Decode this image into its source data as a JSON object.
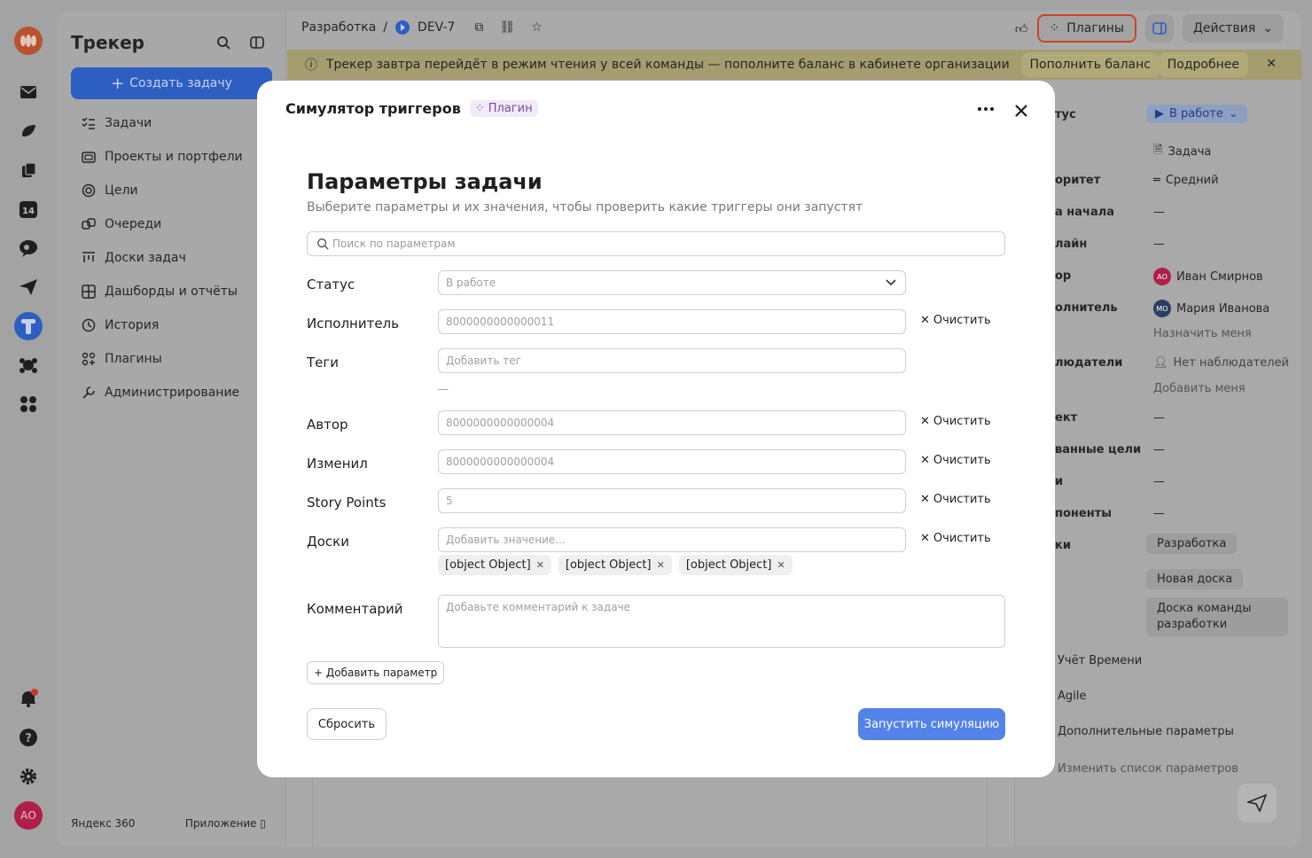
{
  "rail": {
    "avatar_initials": "АО"
  },
  "sidebar": {
    "logo": "Трекер",
    "create_label": "Создать задачу",
    "items": [
      {
        "label": "Задачи"
      },
      {
        "label": "Проекты и портфели"
      },
      {
        "label": "Цели"
      },
      {
        "label": "Очереди"
      },
      {
        "label": "Доски задач"
      },
      {
        "label": "Дашборды и отчёты"
      },
      {
        "label": "История"
      },
      {
        "label": "Плагины"
      },
      {
        "label": "Администрирование"
      }
    ],
    "footer_brand": "Яндекс 360",
    "footer_app": "Приложение"
  },
  "topbar": {
    "crumb_project": "Разработка",
    "crumb_sep": "/",
    "crumb_issue": "DEV-7",
    "plugins_label": "Плагины",
    "actions_label": "Действия"
  },
  "banner": {
    "text": "Трекер завтра перейдёт в режим чтения у всей команды — пополните баланс в кабинете организации",
    "topup_label": "Пополнить баланс",
    "more_label": "Подробнее"
  },
  "right_panel": {
    "status_label": "тус",
    "status_value": "В работе",
    "type_value": "Задача",
    "priority_label": "оритет",
    "priority_value": "Средний",
    "start_label": "а начала",
    "start_value": "—",
    "deadline_label": "лайн",
    "deadline_value": "—",
    "author_label": "ор",
    "author_value": "Иван Смирнов",
    "author_initials": "АО",
    "assignee_label": "олнитель",
    "assignee_value": "Мария Иванова",
    "assignee_initials": "МО",
    "assign_me": "Назначить меня",
    "watchers_label": "людатели",
    "watchers_value": "Нет наблюдателей",
    "add_me": "Добавить меня",
    "project_label": "ект",
    "project_value": "—",
    "goals_label": "ванные цели",
    "goals_value": "—",
    "tags_label": "и",
    "tags_value": "—",
    "components_label": "поненты",
    "components_value": "—",
    "boards_label": "ки",
    "boards": [
      "Разработка",
      "Новая доска",
      "Доска команды разработки"
    ],
    "section_time": "Учёт Времени",
    "section_agile": "Agile",
    "section_extra": "Дополнительные параметры",
    "change_params": "Изменить список параметров"
  },
  "modal": {
    "title": "Симулятор триггеров",
    "badge": "Плагин",
    "heading": "Параметры задачи",
    "subtitle": "Выберите параметры и их значения, чтобы проверить какие триггеры они запустят",
    "search_placeholder": "Поиск по параметрам",
    "clear_label": "Очистить",
    "fields": {
      "status": {
        "label": "Статус",
        "value": "В работе"
      },
      "assignee": {
        "label": "Исполнитель",
        "value": "8000000000000011"
      },
      "tags": {
        "label": "Теги",
        "placeholder": "Добавить тег",
        "empty": "—"
      },
      "author": {
        "label": "Автор",
        "value": "8000000000000004"
      },
      "modified": {
        "label": "Изменил",
        "value": "8000000000000004"
      },
      "story_points": {
        "label": "Story Points",
        "value": "5"
      },
      "boards": {
        "label": "Доски",
        "placeholder": "Добавить значение...",
        "chips": [
          "[object Object]",
          "[object Object]",
          "[object Object]"
        ]
      },
      "comment": {
        "label": "Комментарий",
        "placeholder": "Добавьте комментарий к задаче"
      }
    },
    "add_param_label": "+ Добавить параметр",
    "reset_label": "Сбросить",
    "run_label": "Запустить симуляцию"
  },
  "colors": {
    "primary": "#5382e8",
    "plugin_badge": "#7a4aa8",
    "highlight_border": "#c8452a"
  }
}
